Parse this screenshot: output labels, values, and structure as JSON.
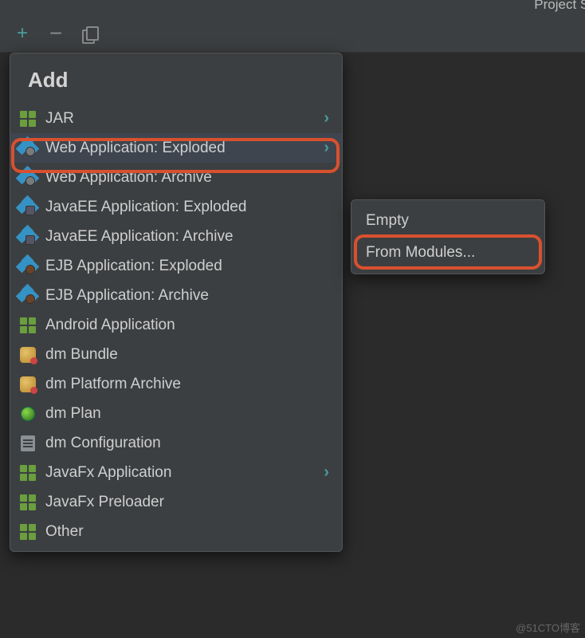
{
  "header": {
    "title_fragment": "Project St"
  },
  "toolbar": {
    "add_tooltip": "Add",
    "remove_tooltip": "Remove",
    "copy_tooltip": "Copy"
  },
  "menu": {
    "title": "Add",
    "items": [
      {
        "label": "JAR",
        "icon": "jar",
        "has_submenu": true
      },
      {
        "label": "Web Application: Exploded",
        "icon": "web",
        "has_submenu": true,
        "highlighted": true
      },
      {
        "label": "Web Application: Archive",
        "icon": "web",
        "has_submenu": false
      },
      {
        "label": "JavaEE Application: Exploded",
        "icon": "ee",
        "has_submenu": false
      },
      {
        "label": "JavaEE Application: Archive",
        "icon": "ee",
        "has_submenu": false
      },
      {
        "label": "EJB Application: Exploded",
        "icon": "ejb",
        "has_submenu": false
      },
      {
        "label": "EJB Application: Archive",
        "icon": "ejb",
        "has_submenu": false
      },
      {
        "label": "Android Application",
        "icon": "jar",
        "has_submenu": false
      },
      {
        "label": "dm Bundle",
        "icon": "bundle",
        "has_submenu": false
      },
      {
        "label": "dm Platform Archive",
        "icon": "bundle",
        "has_submenu": false
      },
      {
        "label": "dm Plan",
        "icon": "plan",
        "has_submenu": false
      },
      {
        "label": "dm Configuration",
        "icon": "conf",
        "has_submenu": false
      },
      {
        "label": "JavaFx Application",
        "icon": "jar",
        "has_submenu": true
      },
      {
        "label": "JavaFx Preloader",
        "icon": "jar",
        "has_submenu": false
      },
      {
        "label": "Other",
        "icon": "jar",
        "has_submenu": false
      }
    ]
  },
  "submenu": {
    "items": [
      {
        "label": "Empty"
      },
      {
        "label": "From Modules...",
        "highlighted": true
      }
    ]
  },
  "watermark": "@51CTO博客"
}
